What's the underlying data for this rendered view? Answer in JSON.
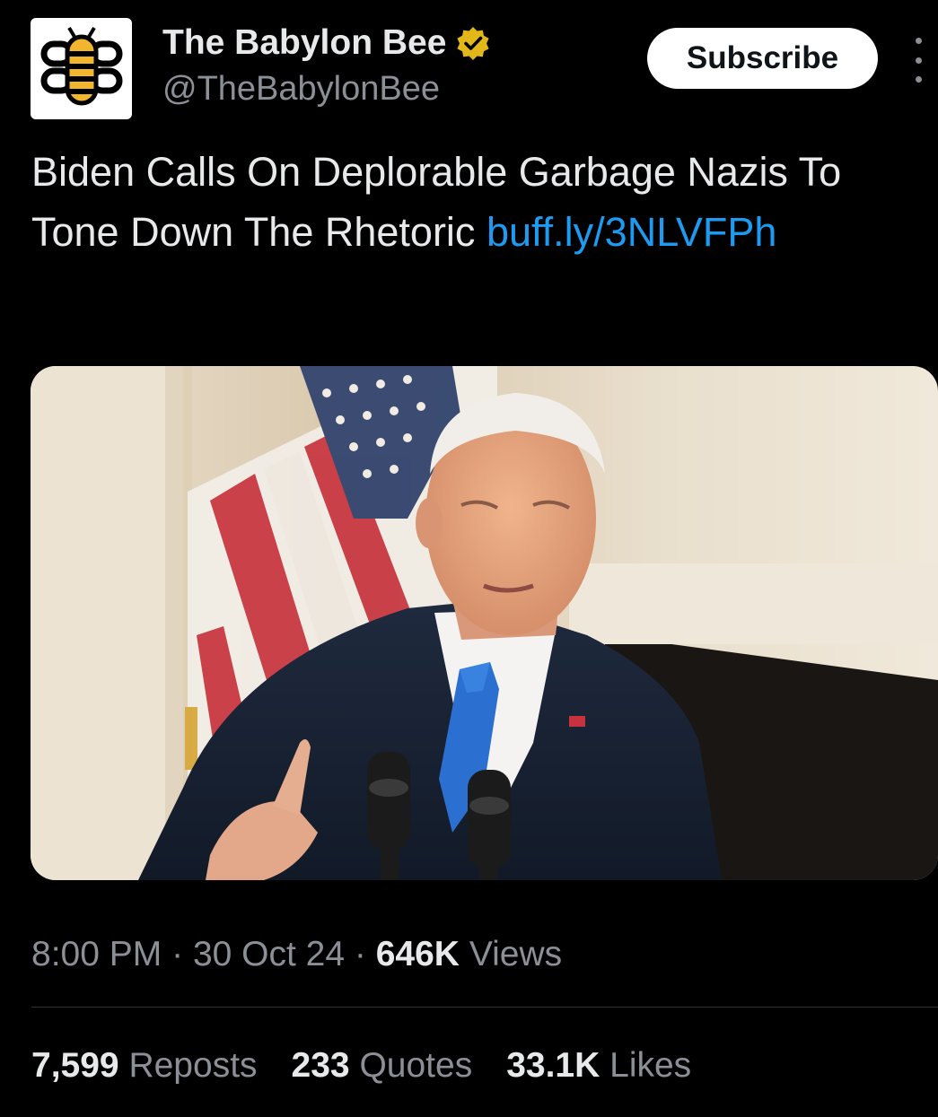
{
  "account": {
    "display_name": "The Babylon Bee",
    "handle": "@TheBabylonBee",
    "verified_icon": "gold-verified-badge-icon",
    "avatar_icon": "babylon-bee-logo",
    "badge_color": "#e2b719"
  },
  "actions": {
    "subscribe_label": "Subscribe",
    "more_icon": "vertical-ellipsis-icon"
  },
  "tweet": {
    "text": "Biden Calls On Deplorable Garbage Nazis To Tone Down The Rhetoric ",
    "link": "buff.ly/3NLVFPh",
    "link_color": "#1d9bf0"
  },
  "media": {
    "type": "photo"
  },
  "meta": {
    "time": "8:00 PM",
    "date": "30 Oct 24",
    "views_count": "646K",
    "views_label": "Views",
    "separator": "·"
  },
  "stats": {
    "reposts_count": "7,599",
    "reposts_label": "Reposts",
    "quotes_count": "233",
    "quotes_label": "Quotes",
    "likes_count": "33.1K",
    "likes_label": "Likes"
  }
}
